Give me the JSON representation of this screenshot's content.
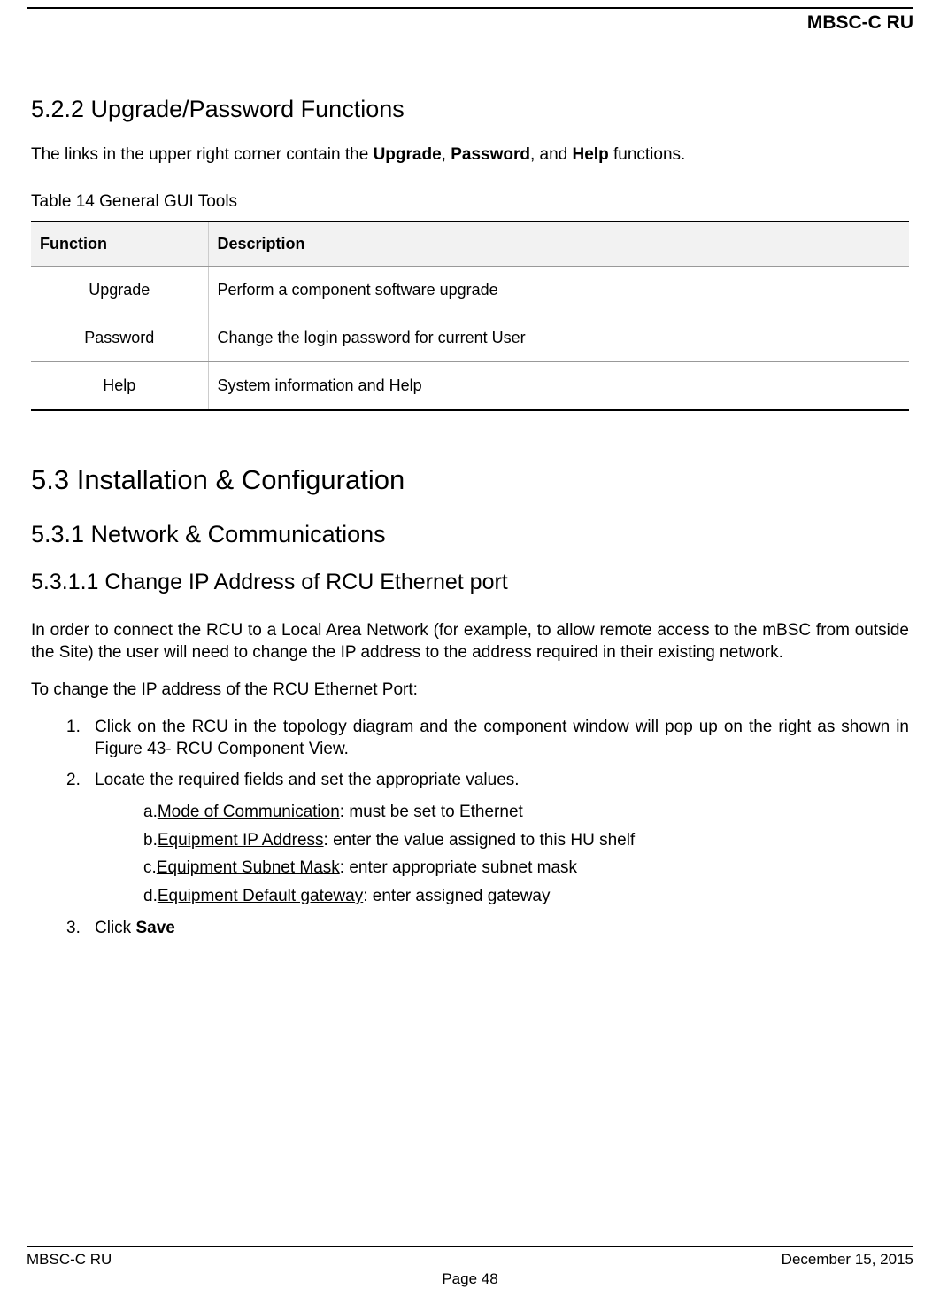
{
  "header": {
    "title": "MBSC-C RU"
  },
  "section_522": {
    "heading": "5.2.2  Upgrade/Password Functions",
    "intro_pre": "The links in the upper right corner contain the ",
    "intro_b1": "Upgrade",
    "intro_sep1": ", ",
    "intro_b2": "Password",
    "intro_sep2": ", and ",
    "intro_b3": "Help",
    "intro_post": " functions."
  },
  "table14": {
    "caption": "Table 14 General GUI Tools",
    "headers": [
      "Function",
      "Description"
    ],
    "rows": [
      {
        "func": "Upgrade",
        "desc": "Perform a component   software upgrade"
      },
      {
        "func": "Password",
        "desc": "Change the login password for current User"
      },
      {
        "func": "Help",
        "desc": "System information and Help"
      }
    ]
  },
  "section_53": {
    "heading": "5.3    Installation & Configuration"
  },
  "section_531": {
    "heading": "5.3.1  Network & Communications"
  },
  "section_5311": {
    "heading": "5.3.1.1    Change IP Address of RCU Ethernet port",
    "para1": "In order to connect the RCU to a Local Area Network (for example, to allow remote access to the mBSC from outside the Site) the user will need to change the IP address to the address required in their existing network.",
    "para2": "To change the IP address of the RCU Ethernet Port:",
    "steps": [
      {
        "num": "1.",
        "text": "Click on the RCU in the topology diagram and the component window will pop up on the right as shown in Figure 43- RCU Component View."
      },
      {
        "num": "2.",
        "text": "Locate the required fields and set the appropriate values.",
        "sub": [
          {
            "letter": "a.",
            "label": "Mode of Communication",
            "rest": ": must be set to Ethernet"
          },
          {
            "letter": "b.",
            "label": "Equipment IP Address",
            "rest": ": enter the value assigned to this HU shelf"
          },
          {
            "letter": "c.",
            "label": "Equipment Subnet Mask",
            "rest": ": enter appropriate subnet mask"
          },
          {
            "letter": "d.",
            "label": "Equipment Default gateway",
            "rest": ": enter assigned gateway"
          }
        ]
      },
      {
        "num": "3.",
        "text_pre": "Click ",
        "text_bold": "Save"
      }
    ]
  },
  "footer": {
    "left": "MBSC-C RU",
    "right": "December 15, 2015",
    "center": "Page 48"
  }
}
